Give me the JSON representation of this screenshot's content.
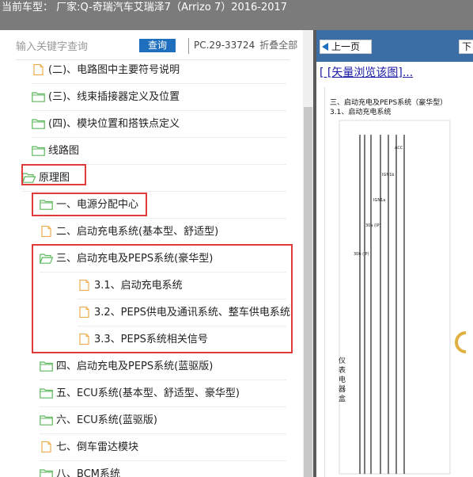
{
  "header": {
    "title": "当前车型： 厂家:Q-奇瑞汽车艾瑞泽7（Arrizo 7）2016-2017"
  },
  "search": {
    "placeholder": "输入关键字查询",
    "button_label": "查询",
    "part_number": "PC.29-33724",
    "collapse_label": "折叠全部"
  },
  "tree": [
    {
      "label": "(二)、电路图中主要符号说明",
      "icon": "document-icon"
    },
    {
      "label": "(三)、线束插接器定义及位置",
      "icon": "folder-icon"
    },
    {
      "label": "(四)、模块位置和搭铁点定义",
      "icon": "folder-icon"
    },
    {
      "label": "线路图",
      "icon": "folder-icon"
    },
    {
      "label": "原理图",
      "icon": "folder-open-icon"
    },
    {
      "label": "一、电源分配中心",
      "icon": "folder-icon"
    },
    {
      "label": "二、启动充电系统(基本型、舒适型)",
      "icon": "document-icon"
    },
    {
      "label": "三、启动充电及PEPS系统(豪华型)",
      "icon": "folder-open-icon"
    },
    {
      "label": "3.1、启动充电系统",
      "icon": "document-icon"
    },
    {
      "label": "3.2、PEPS供电及通讯系统、整车供电系统",
      "icon": "document-icon"
    },
    {
      "label": "3.3、PEPS系统相关信号",
      "icon": "document-icon"
    },
    {
      "label": "四、启动充电及PEPS系统(蓝驱版)",
      "icon": "folder-icon"
    },
    {
      "label": "五、ECU系统(基本型、舒适型、豪华型)",
      "icon": "folder-icon"
    },
    {
      "label": "六、ECU系统(蓝驱版)",
      "icon": "folder-icon"
    },
    {
      "label": "七、倒车雷达模块",
      "icon": "document-icon"
    },
    {
      "label": "八、BCM系统",
      "icon": "folder-icon"
    }
  ],
  "viewer": {
    "prev_label": "上一页",
    "next_label": "下",
    "vector_link": "[ [矢量浏览该图]...",
    "doc_title": "三、启动充电及PEPS系统（豪华型）",
    "doc_subtitle": "3.1、启动充电系统",
    "diagram_labels": {
      "acc": "ACC",
      "ign1b": "IGN1b",
      "ign1a": "IGN1a",
      "w30a": "30a (IP)",
      "w30b": "30b (IP)",
      "box": "仪表电器盒"
    }
  },
  "colors": {
    "header_bg": "#7b7b7b",
    "accent": "#1e6fbe",
    "highlight": "#e03a3a",
    "folder": "#5cb85c",
    "document": "#f0ad4e",
    "viewer_bar": "#3b6ea5"
  }
}
